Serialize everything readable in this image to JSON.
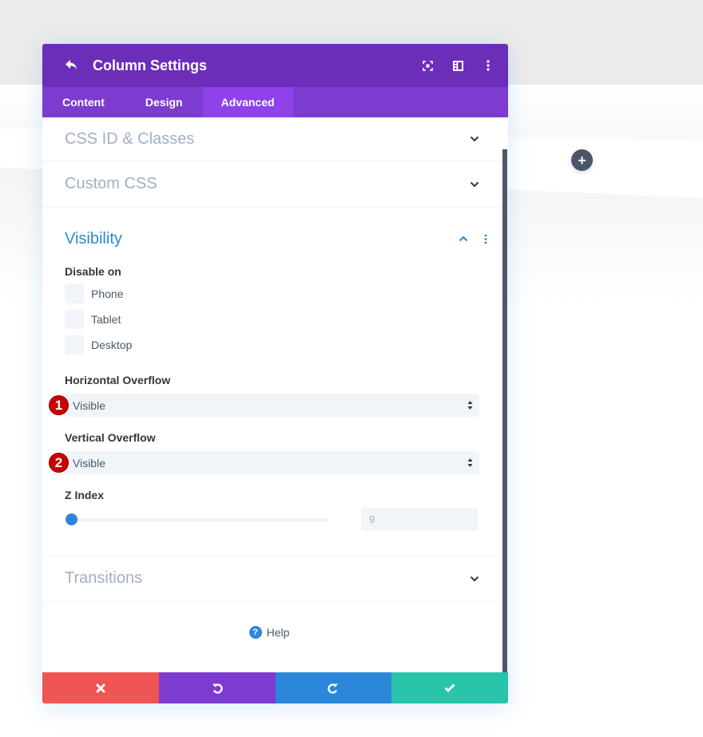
{
  "background": {
    "add_button_icon": "plus-icon"
  },
  "modal": {
    "title": "Column Settings",
    "header_icons": [
      "back-icon",
      "fullscreen-icon",
      "split-view-icon",
      "more-options-icon"
    ],
    "tabs": [
      {
        "label": "Content",
        "active": false
      },
      {
        "label": "Design",
        "active": false
      },
      {
        "label": "Advanced",
        "active": true
      }
    ],
    "sections": {
      "css_id": {
        "title": "CSS ID & Classes",
        "expanded": false
      },
      "custom_css": {
        "title": "Custom CSS",
        "expanded": false
      },
      "visibility": {
        "title": "Visibility",
        "expanded": true,
        "disable_on_label": "Disable on",
        "devices": [
          {
            "label": "Phone",
            "checked": false
          },
          {
            "label": "Tablet",
            "checked": false
          },
          {
            "label": "Desktop",
            "checked": false
          }
        ],
        "horizontal_overflow": {
          "label": "Horizontal Overflow",
          "value": "Visible",
          "annotation": "1"
        },
        "vertical_overflow": {
          "label": "Vertical Overflow",
          "value": "Visible",
          "annotation": "2"
        },
        "z_index": {
          "label": "Z Index",
          "value": "9",
          "slider_fraction": 0.0
        }
      },
      "transitions": {
        "title": "Transitions",
        "expanded": false
      }
    },
    "help_label": "Help",
    "footer": {
      "cancel_icon": "close-icon",
      "undo_icon": "undo-icon",
      "redo_icon": "redo-icon",
      "save_icon": "check-icon"
    },
    "colors": {
      "header": "#6c2eb9",
      "tabs": "#7e3bd0",
      "active_tab": "#8f42ec",
      "accent_blue": "#2b87da",
      "cancel": "#ef5555",
      "undo": "#7e3bd0",
      "redo": "#2b87da",
      "save": "#29c4a9",
      "annotation": "#cc0000"
    }
  }
}
